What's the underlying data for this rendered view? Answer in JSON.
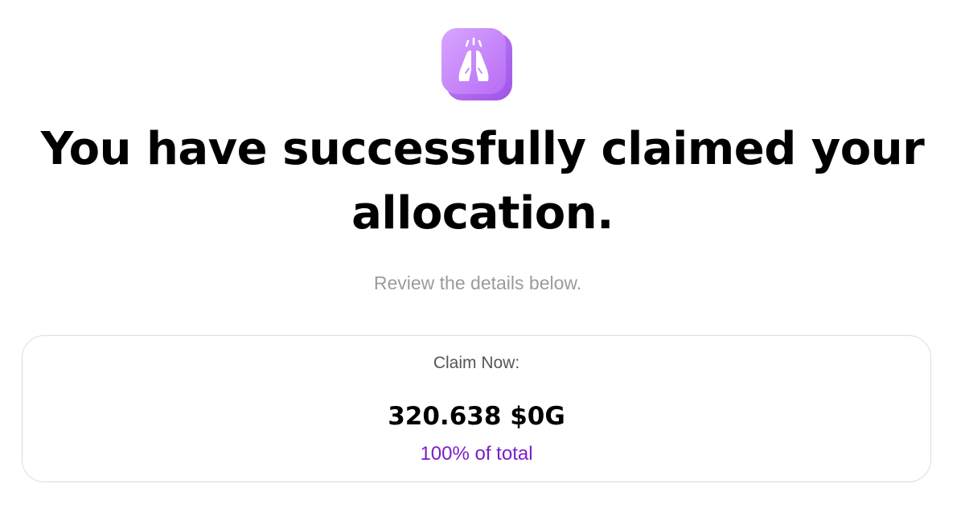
{
  "hero": {
    "icon": "praying-hands-icon",
    "icon_color": "#c77dff"
  },
  "heading": {
    "title": "You have successfully claimed your allocation."
  },
  "subheading": {
    "text": "Review the details below."
  },
  "claim": {
    "label": "Claim Now:",
    "amount": "320.638 $0G",
    "percent_text": "100% of total",
    "percent_color": "#7a1fc9"
  }
}
